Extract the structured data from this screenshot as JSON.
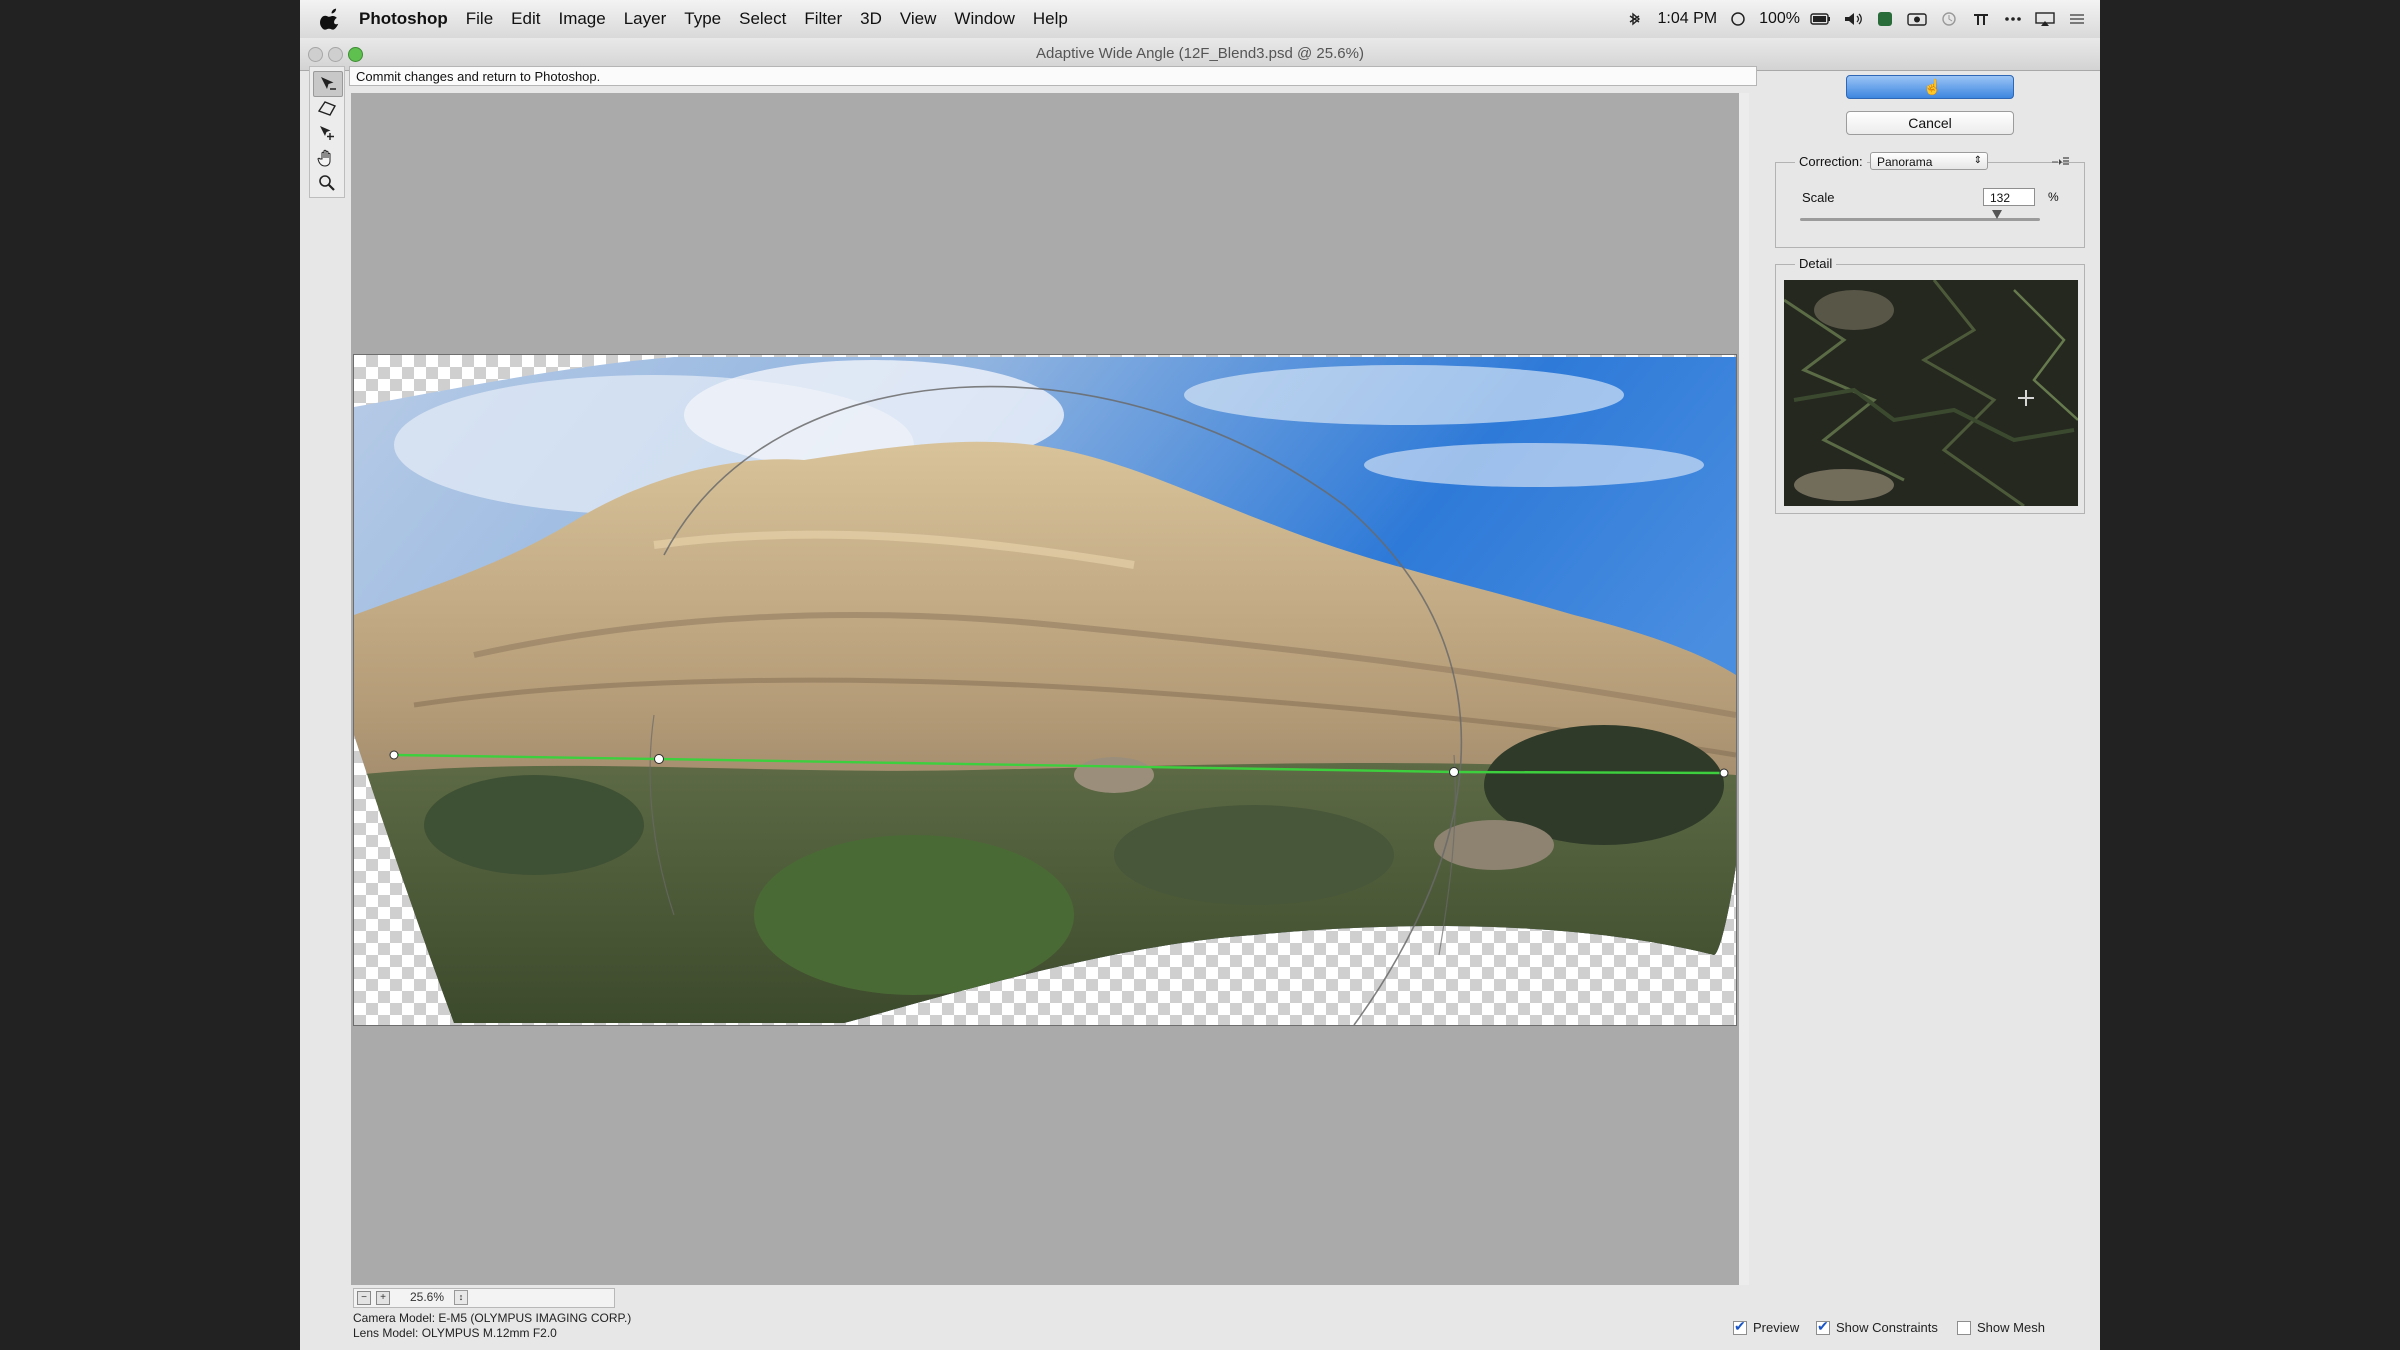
{
  "menubar": {
    "items": [
      "Photoshop",
      "File",
      "Edit",
      "Image",
      "Layer",
      "Type",
      "Select",
      "Filter",
      "3D",
      "View",
      "Window",
      "Help"
    ],
    "time": "1:04 PM",
    "battery": "100%"
  },
  "window": {
    "title": "Adaptive Wide Angle (12F_Blend3.psd @ 25.6%)"
  },
  "hint": "Commit changes and return to Photoshop.",
  "tools": [
    "constraint-tool",
    "polygon-constraint-tool",
    "move-tool",
    "hand-tool",
    "zoom-tool"
  ],
  "buttons": {
    "ok": "OK",
    "cancel": "Cancel"
  },
  "correction": {
    "label": "Correction:",
    "value": "Panorama"
  },
  "scale": {
    "label": "Scale",
    "value": "132",
    "unit": "%",
    "slider_fraction": 0.82
  },
  "detail": {
    "label": "Detail"
  },
  "zoom": {
    "value": "25.6%"
  },
  "camera": {
    "model": "Camera Model: E-M5 (OLYMPUS IMAGING CORP.)",
    "lens": "Lens Model: OLYMPUS M.12mm F2.0"
  },
  "options": {
    "preview": "Preview",
    "show_constraints": "Show Constraints",
    "show_mesh": "Show Mesh"
  },
  "colors": {
    "constraint_line": "#3ecf3e",
    "ok_button": "#3d86e0"
  }
}
